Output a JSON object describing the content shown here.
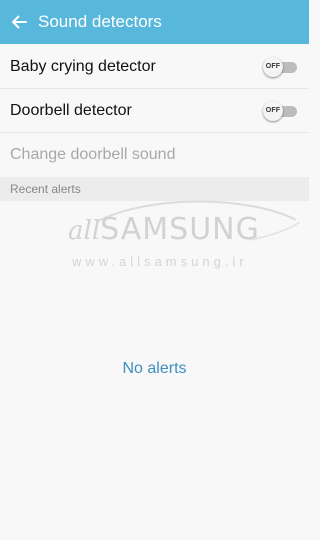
{
  "app_bar": {
    "title": "Sound detectors",
    "background": "#57b8dc",
    "back_icon": "arrow-left-icon"
  },
  "settings": [
    {
      "label": "Baby crying detector",
      "toggle": "OFF",
      "enabled": false
    },
    {
      "label": "Doorbell detector",
      "toggle": "OFF",
      "enabled": false
    },
    {
      "label": "Change doorbell sound",
      "disabled": true
    }
  ],
  "recent_alerts": {
    "header": "Recent alerts",
    "empty_text": "No alerts"
  },
  "watermark": {
    "logo_part1": "all",
    "logo_part2": "SAMSUNG",
    "url": "www.allsamsung.ir"
  },
  "colors": {
    "accent": "#57b8dc",
    "empty_text": "#3d8fbf",
    "disabled_text": "#a8a8a8"
  }
}
